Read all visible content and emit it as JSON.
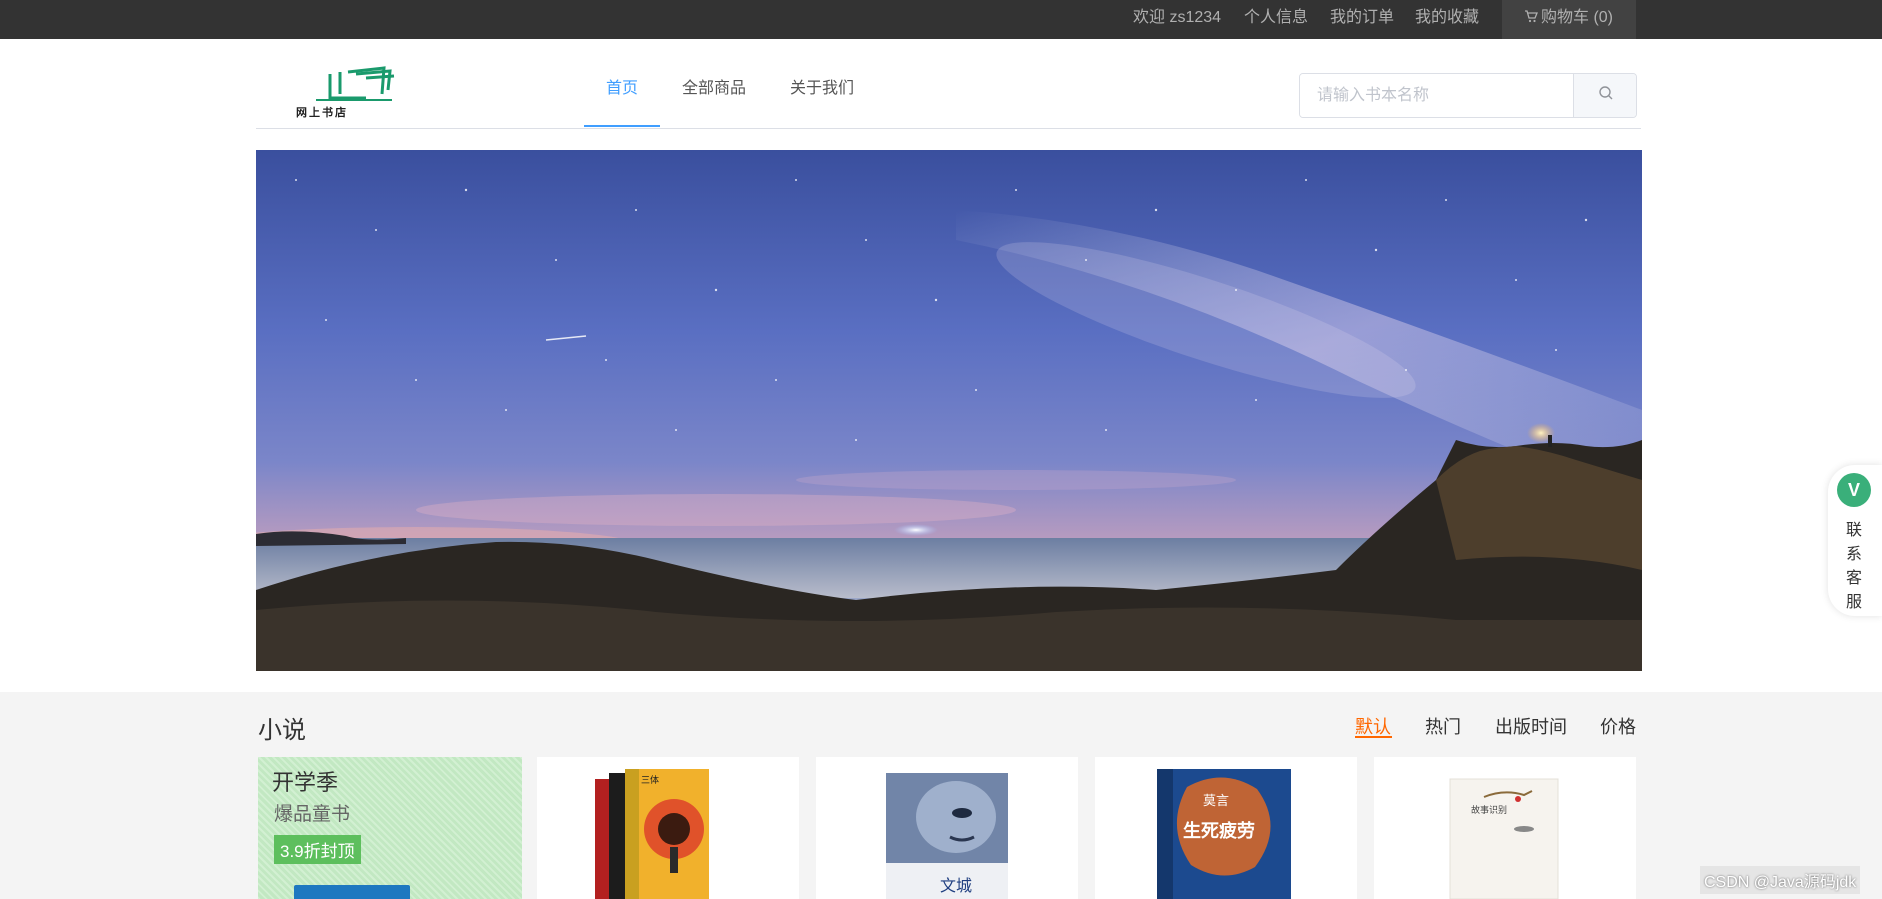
{
  "topbar": {
    "welcome": "欢迎 zs1234",
    "profile": "个人信息",
    "orders": "我的订单",
    "favorites": "我的收藏",
    "cart": "购物车 (0)"
  },
  "nav": {
    "items": [
      {
        "label": "首页",
        "active": true
      },
      {
        "label": "全部商品",
        "active": false
      },
      {
        "label": "关于我们",
        "active": false
      }
    ]
  },
  "brand": {
    "logo_text": "网上书店",
    "color": "#1a9a6c"
  },
  "search": {
    "placeholder": "请输入书本名称"
  },
  "section": {
    "title": "小说",
    "sort_options": [
      {
        "label": "默认",
        "active": true
      },
      {
        "label": "热门",
        "active": false
      },
      {
        "label": "出版时间",
        "active": false
      },
      {
        "label": "价格",
        "active": false
      }
    ],
    "promo": {
      "line1": "开学季",
      "line2": "爆品童书",
      "badge": "3.9折封顶"
    },
    "books": [
      {
        "cover_text": "三体"
      },
      {
        "cover_text": "文城"
      },
      {
        "cover_text": "生死疲劳",
        "author": "莫言"
      },
      {
        "cover_text": "故事识别"
      }
    ]
  },
  "service": {
    "icon": "V",
    "label": "联系客服"
  },
  "watermark": "CSDN @Java源码jdk",
  "colors": {
    "accent": "#409eff",
    "sort_active": "#ff6700",
    "topbar_bg": "#333333"
  }
}
